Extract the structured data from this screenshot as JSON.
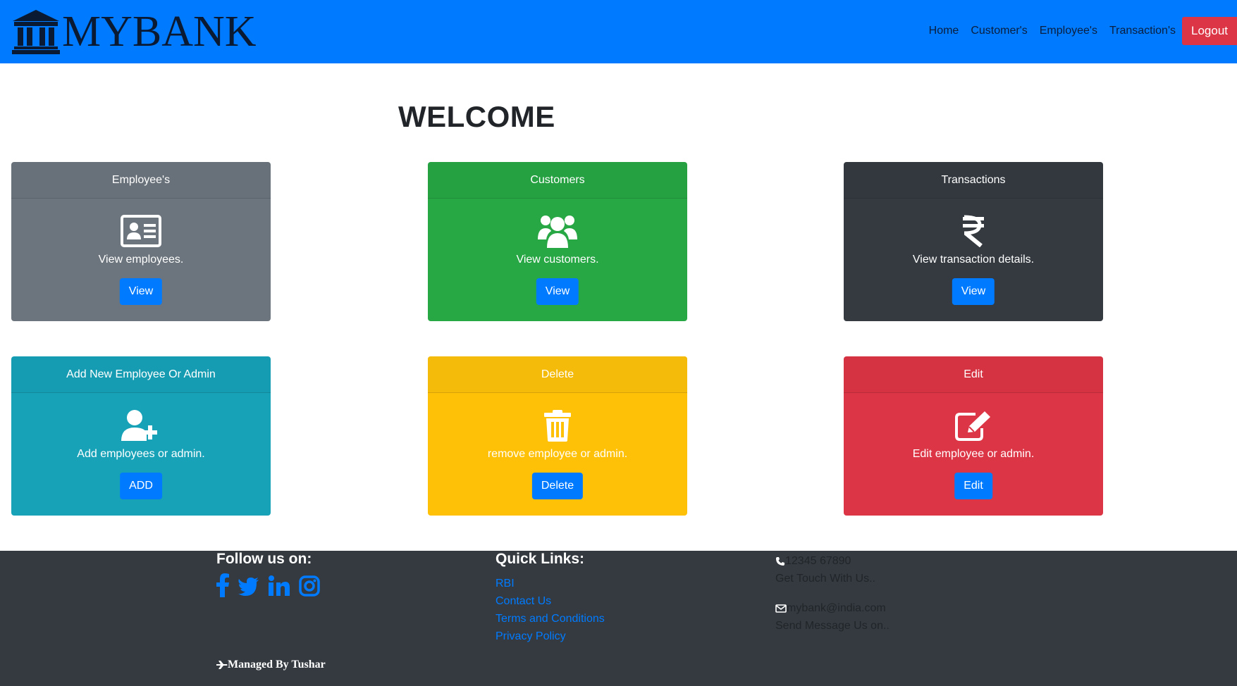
{
  "brand": {
    "name": "MYBANK",
    "icon": "bank-icon"
  },
  "nav": {
    "links": [
      "Home",
      "Customer's",
      "Employee's",
      "Transaction's"
    ],
    "logout_label": "Logout",
    "logout_color": "#dc3545",
    "bar_color": "#007bff"
  },
  "main": {
    "title": "WELCOME"
  },
  "cards": [
    {
      "header": "Employee's",
      "icon": "id-card-icon",
      "text": "View employees.",
      "button": "View",
      "color": "#6c757d"
    },
    {
      "header": "Customers",
      "icon": "users-icon",
      "text": "View customers.",
      "button": "View",
      "color": "#28a745"
    },
    {
      "header": "Transactions",
      "icon": "rupee-icon",
      "text": "View transaction details.",
      "button": "View",
      "color": "#343a40"
    },
    {
      "header": "Add New Employee Or Admin",
      "icon": "user-plus-icon",
      "text": "Add employees or admin.",
      "button": "ADD",
      "color": "#17a2b8"
    },
    {
      "header": "Delete",
      "icon": "trash-icon",
      "text": "remove employee or admin.",
      "button": "Delete",
      "color": "#ffc107"
    },
    {
      "header": "Edit",
      "icon": "edit-icon",
      "text": "Edit employee or admin.",
      "button": "Edit",
      "color": "#dc3545"
    }
  ],
  "footer": {
    "follow_title": "Follow us on:",
    "social_icons": [
      "facebook-icon",
      "twitter-icon",
      "linkedin-icon",
      "instagram-icon"
    ],
    "quick_title": "Quick Links:",
    "quick_links": [
      "RBI",
      "Contact Us",
      "Terms and Conditions",
      "Privacy Policy"
    ],
    "phone": "12345 67890",
    "phone_caption": "Get Touch With Us..",
    "email": "mybank@india.com",
    "email_caption": "Send Message Us on..",
    "managed_by": "Managed By Tushar",
    "background": "#343a40",
    "link_color": "#007bff"
  }
}
